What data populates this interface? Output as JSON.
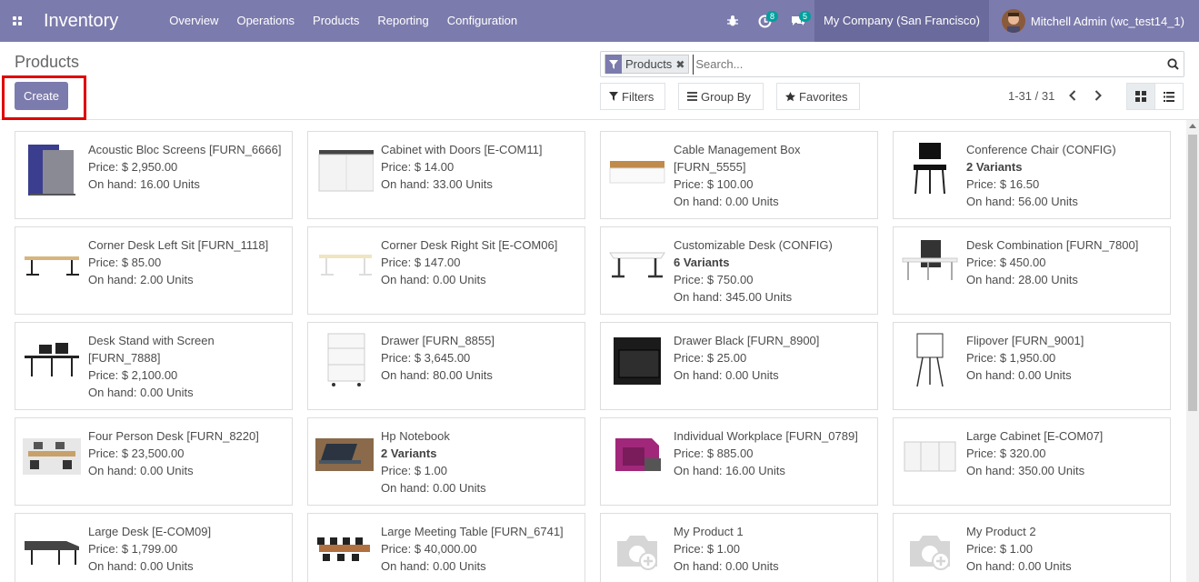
{
  "navbar": {
    "app_title": "Inventory",
    "menu": [
      "Overview",
      "Operations",
      "Products",
      "Reporting",
      "Configuration"
    ],
    "activity_count": "8",
    "message_count": "5",
    "company": "My Company (San Francisco)",
    "user": "Mitchell Admin (wc_test14_1)"
  },
  "control_panel": {
    "breadcrumb": "Products",
    "create_label": "Create",
    "search_facet": "Products",
    "search_placeholder": "Search...",
    "filters_label": "Filters",
    "group_by_label": "Group By",
    "favorites_label": "Favorites",
    "pager": "1-31 / 31"
  },
  "products": [
    {
      "name": "Acoustic Bloc Screens [FURN_6666]",
      "variants": "",
      "price": "Price: $ 2,950.00",
      "onhand": "On hand: 16.00 Units",
      "thumb": "screens"
    },
    {
      "name": "Cabinet with Doors [E-COM11]",
      "variants": "",
      "price": "Price: $ 14.00",
      "onhand": "On hand: 33.00 Units",
      "thumb": "cabinet"
    },
    {
      "name": "Cable Management Box [FURN_5555]",
      "variants": "",
      "price": "Price: $ 100.00",
      "onhand": "On hand: 0.00 Units",
      "thumb": "box"
    },
    {
      "name": "Conference Chair (CONFIG)",
      "variants": "2 Variants",
      "price": "Price: $ 16.50",
      "onhand": "On hand: 56.00 Units",
      "thumb": "chair"
    },
    {
      "name": "Corner Desk Left Sit [FURN_1118]",
      "variants": "",
      "price": "Price: $ 85.00",
      "onhand": "On hand: 2.00 Units",
      "thumb": "desk"
    },
    {
      "name": "Corner Desk Right Sit [E-COM06]",
      "variants": "",
      "price": "Price: $ 147.00",
      "onhand": "On hand: 0.00 Units",
      "thumb": "desk-light"
    },
    {
      "name": "Customizable Desk (CONFIG)",
      "variants": "6 Variants",
      "price": "Price: $ 750.00",
      "onhand": "On hand: 345.00 Units",
      "thumb": "desk-white"
    },
    {
      "name": "Desk Combination [FURN_7800]",
      "variants": "",
      "price": "Price: $ 450.00",
      "onhand": "On hand: 28.00 Units",
      "thumb": "desk-combo"
    },
    {
      "name": "Desk Stand with Screen [FURN_7888]",
      "variants": "",
      "price": "Price: $ 2,100.00",
      "onhand": "On hand: 0.00 Units",
      "thumb": "desk-stand"
    },
    {
      "name": "Drawer [FURN_8855]",
      "variants": "",
      "price": "Price: $ 3,645.00",
      "onhand": "On hand: 80.00 Units",
      "thumb": "drawer"
    },
    {
      "name": "Drawer Black [FURN_8900]",
      "variants": "",
      "price": "Price: $ 25.00",
      "onhand": "On hand: 0.00 Units",
      "thumb": "drawer-black"
    },
    {
      "name": "Flipover [FURN_9001]",
      "variants": "",
      "price": "Price: $ 1,950.00",
      "onhand": "On hand: 0.00 Units",
      "thumb": "flipover"
    },
    {
      "name": "Four Person Desk [FURN_8220]",
      "variants": "",
      "price": "Price: $ 23,500.00",
      "onhand": "On hand: 0.00 Units",
      "thumb": "office"
    },
    {
      "name": "Hp Notebook",
      "variants": "2 Variants",
      "price": "Price: $ 1.00",
      "onhand": "On hand: 0.00 Units",
      "thumb": "laptop"
    },
    {
      "name": "Individual Workplace [FURN_0789]",
      "variants": "",
      "price": "Price: $ 885.00",
      "onhand": "On hand: 16.00 Units",
      "thumb": "pod"
    },
    {
      "name": "Large Cabinet [E-COM07]",
      "variants": "",
      "price": "Price: $ 320.00",
      "onhand": "On hand: 350.00 Units",
      "thumb": "cabinet-large"
    },
    {
      "name": "Large Desk [E-COM09]",
      "variants": "",
      "price": "Price: $ 1,799.00",
      "onhand": "On hand: 0.00 Units",
      "thumb": "desk-large"
    },
    {
      "name": "Large Meeting Table [FURN_6741]",
      "variants": "",
      "price": "Price: $ 40,000.00",
      "onhand": "On hand: 0.00 Units",
      "thumb": "meeting"
    },
    {
      "name": "My Product 1",
      "variants": "",
      "price": "Price: $ 1.00",
      "onhand": "On hand: 0.00 Units",
      "thumb": "placeholder"
    },
    {
      "name": "My Product 2",
      "variants": "",
      "price": "Price: $ 1.00",
      "onhand": "On hand: 0.00 Units",
      "thumb": "placeholder"
    }
  ],
  "colors": {
    "brand": "#7c7bad",
    "badge": "#00a09d",
    "highlight": "#e00000"
  }
}
